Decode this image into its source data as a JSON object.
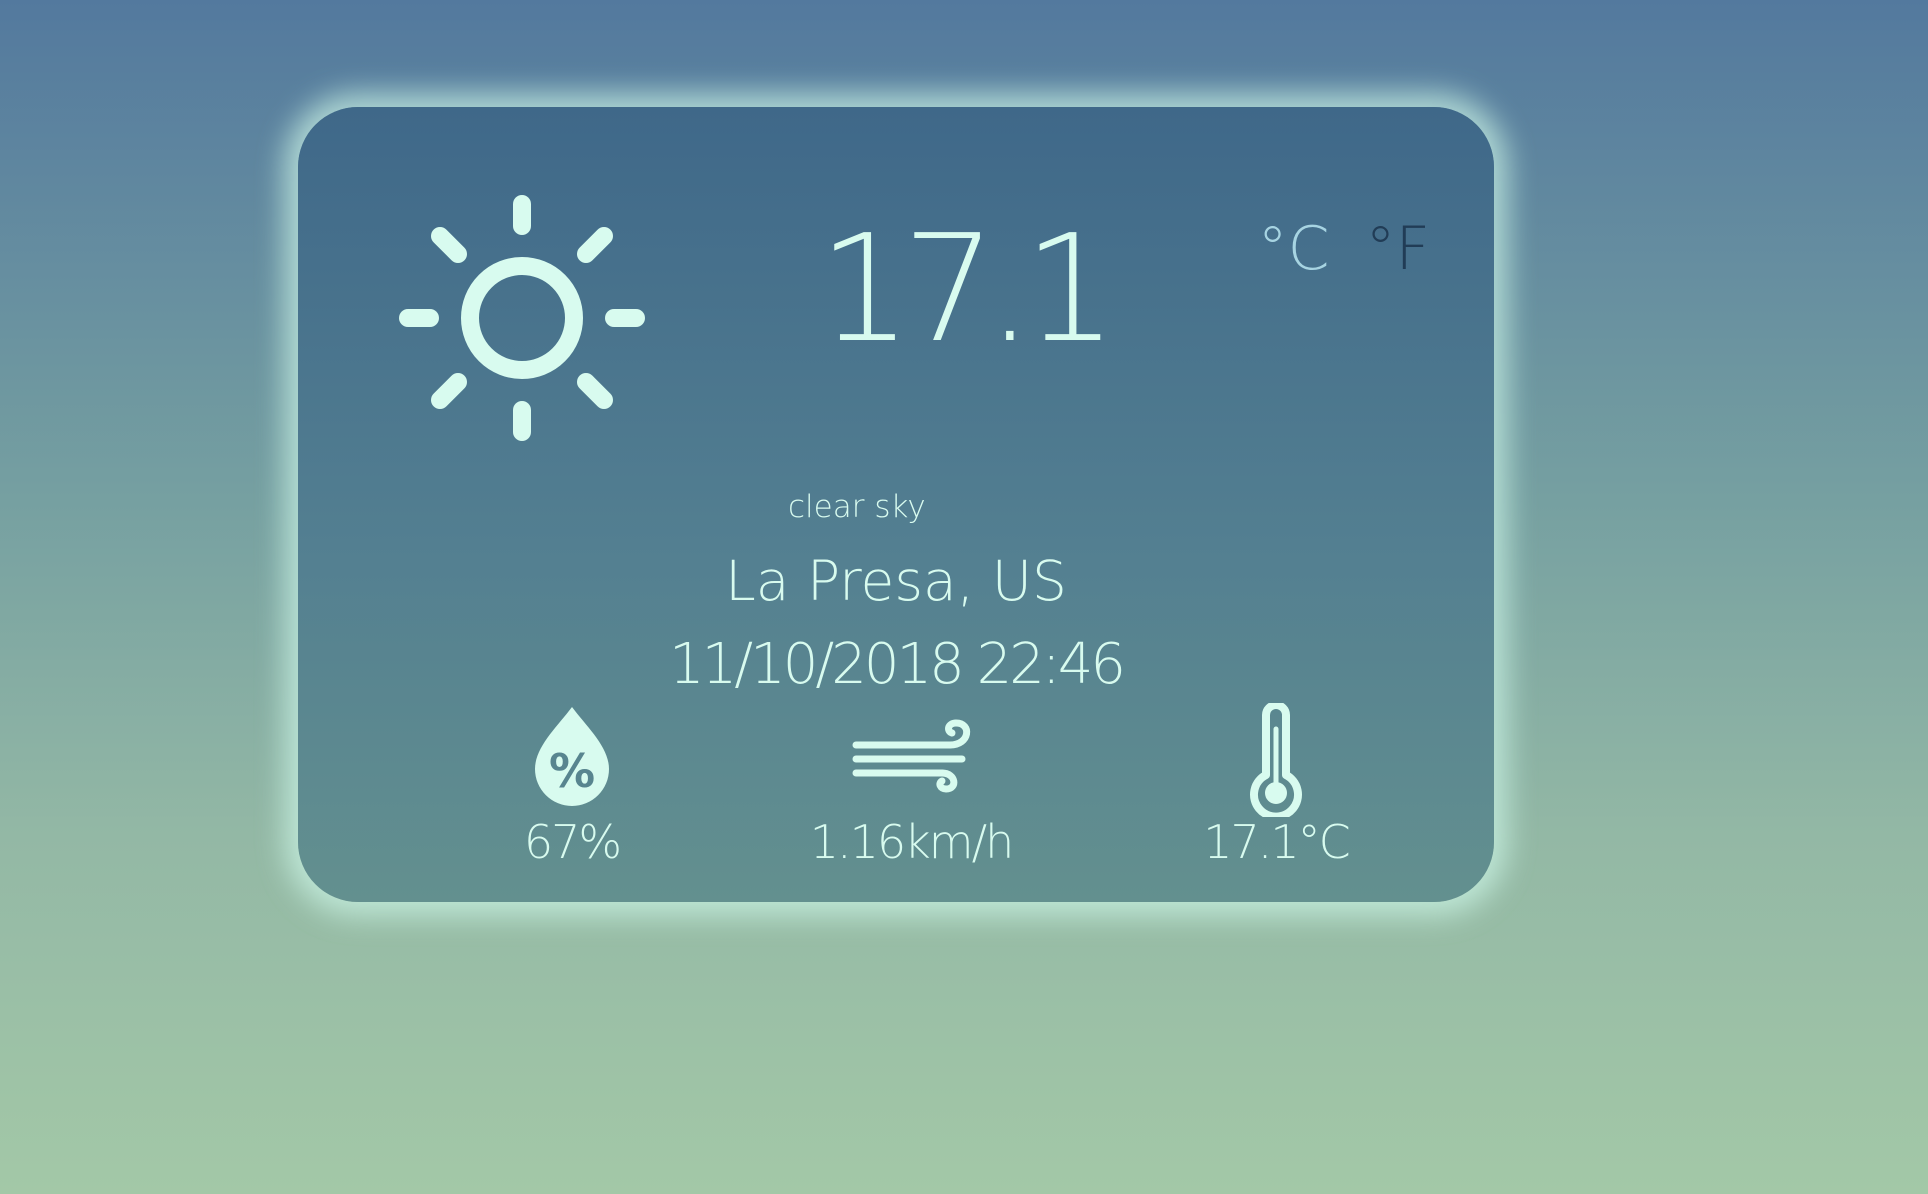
{
  "weather": {
    "icon": "sun-icon",
    "temperature": "17.1",
    "description": "clear sky",
    "location": "La Presa, US",
    "datetime": "11/10/2018 22:46"
  },
  "units": {
    "celsius_label": "°C",
    "fahrenheit_label": "°F",
    "active": "celsius"
  },
  "stats": {
    "humidity": {
      "icon": "humidity-drop-icon",
      "value": "67%"
    },
    "wind": {
      "icon": "wind-icon",
      "value": "1.16km/h"
    },
    "feels_like": {
      "icon": "thermometer-icon",
      "value": "17.1°C"
    }
  },
  "colors": {
    "text": "#d8fbef",
    "active_unit": "#a7d4e2",
    "inactive_unit": "#213c56",
    "card_glow": "#cdf7e8"
  }
}
